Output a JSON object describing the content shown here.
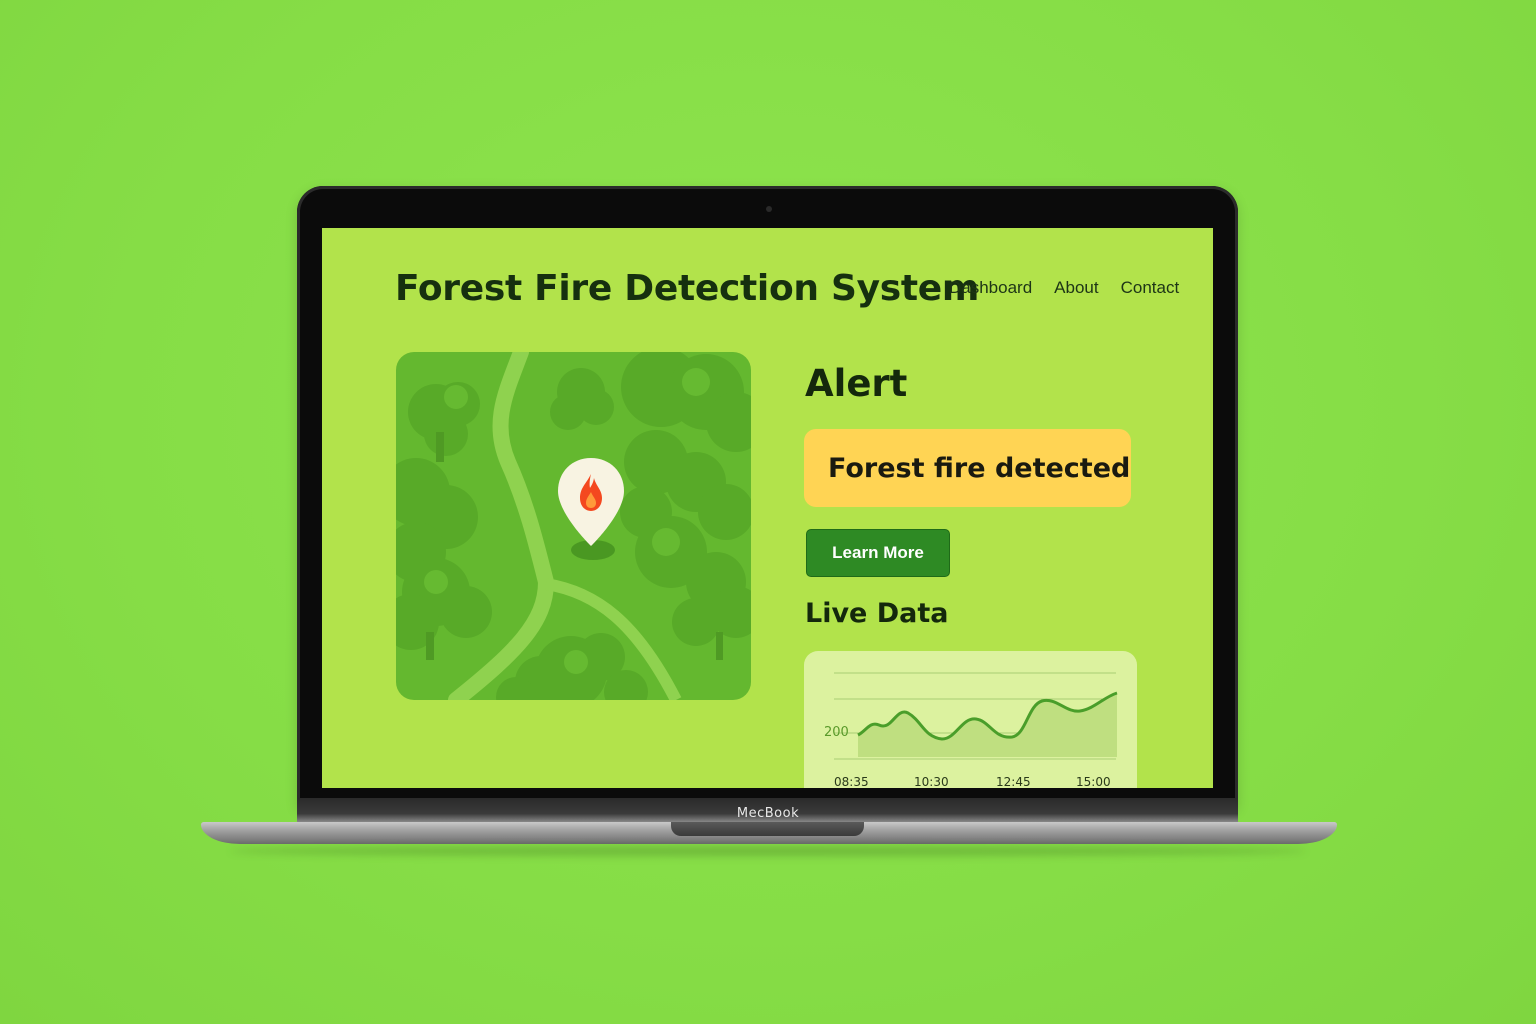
{
  "device": {
    "brand_label": "MecBook"
  },
  "header": {
    "title": "Forest Fire Detection System",
    "nav": [
      {
        "label": "Dashboard"
      },
      {
        "label": "About"
      },
      {
        "label": "Contact"
      }
    ]
  },
  "map": {
    "marker_icon": "fire-location-pin-icon",
    "marker_color": "#f4481f"
  },
  "alert": {
    "heading": "Alert",
    "message": "Forest fire detected",
    "button_label": "Learn More",
    "box_color": "#ffd454",
    "button_color": "#2e8a24"
  },
  "live_data": {
    "heading": "Live Data",
    "y_tick": "200",
    "x_ticks": [
      "08:35",
      "10:30",
      "12:45",
      "15:00"
    ],
    "line_color": "#4a9e2a"
  }
}
